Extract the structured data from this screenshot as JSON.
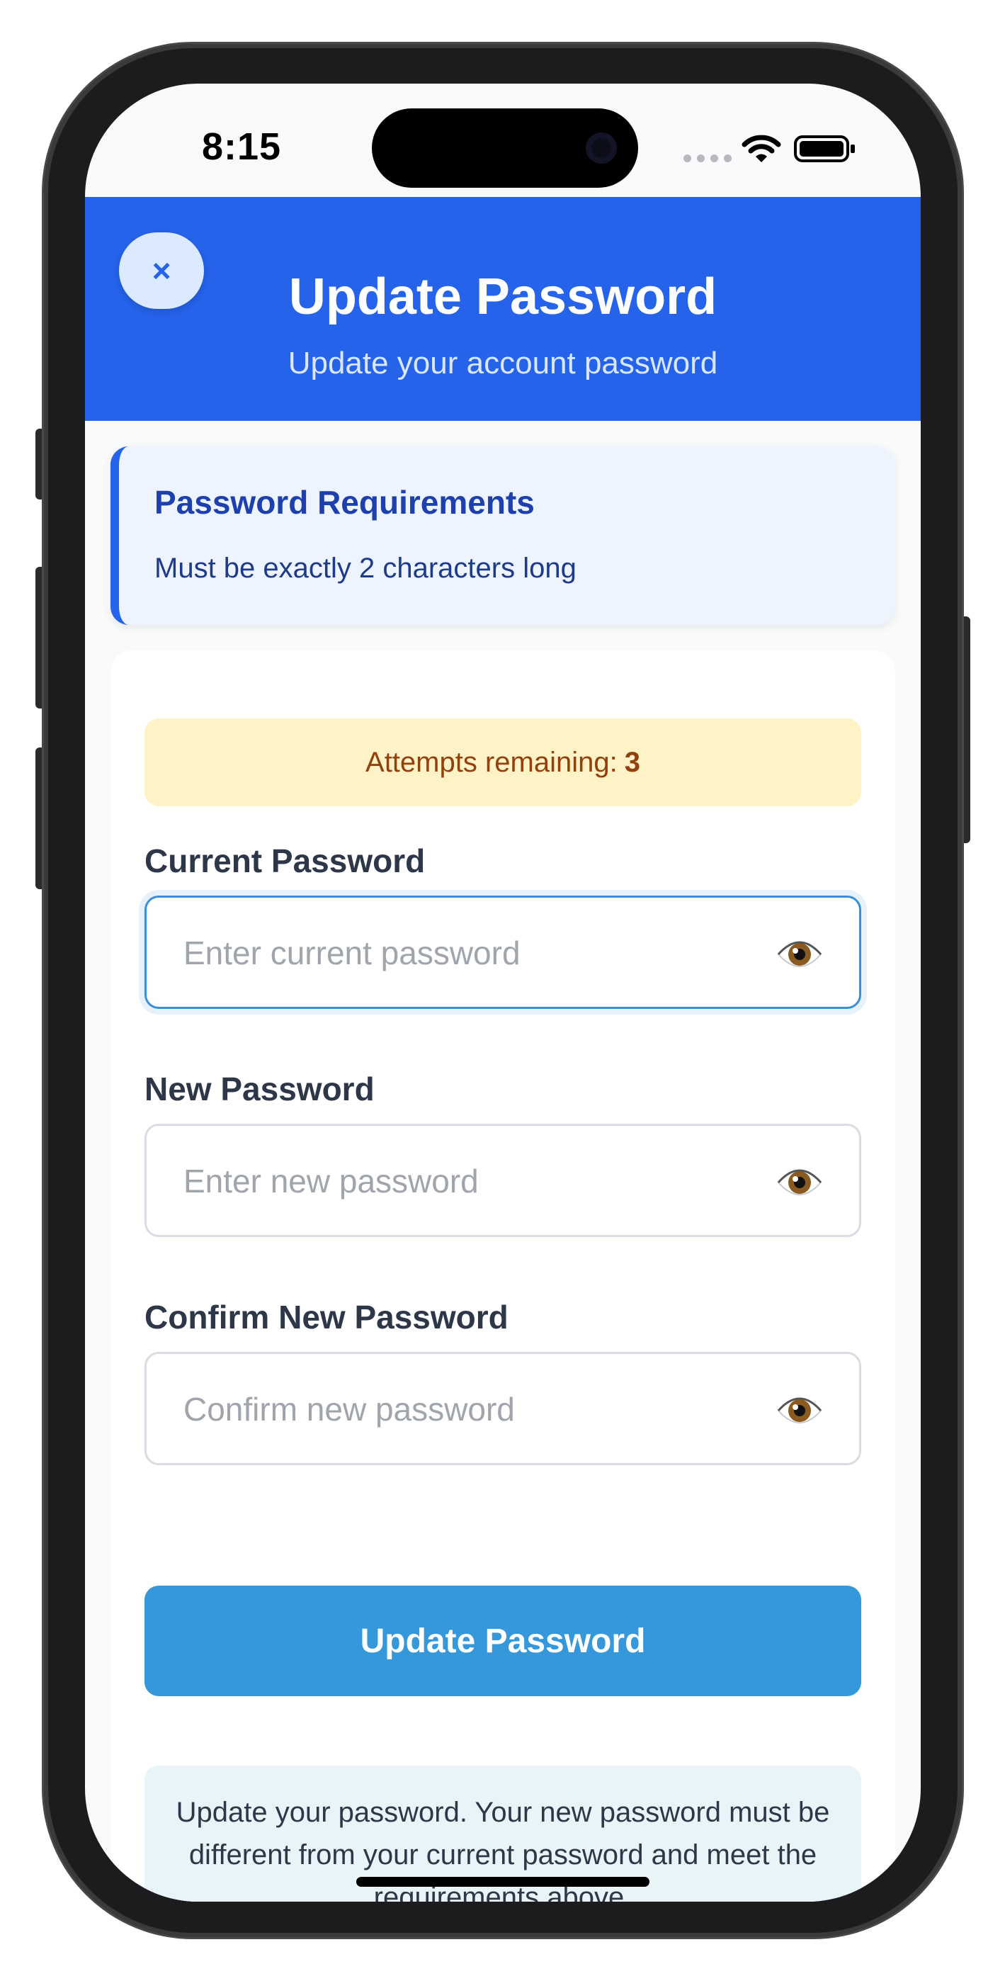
{
  "status_bar": {
    "time": "8:15"
  },
  "header": {
    "close_icon": "×",
    "title": "Update Password",
    "subtitle": "Update your account password"
  },
  "requirements": {
    "title": "Password Requirements",
    "text": "Must be exactly 2 characters long"
  },
  "attempts": {
    "label": "Attempts remaining:",
    "count": "3"
  },
  "fields": {
    "current": {
      "label": "Current Password",
      "placeholder": "Enter current password",
      "value": ""
    },
    "new": {
      "label": "New Password",
      "placeholder": "Enter new password",
      "value": ""
    },
    "confirm": {
      "label": "Confirm New Password",
      "placeholder": "Confirm new password",
      "value": ""
    }
  },
  "submit_label": "Update Password",
  "info_text": "Update your password. Your new password must be different from your current password and meet the requirements above.",
  "colors": {
    "header": "#2563eb",
    "requirements_bg": "#eef4fd",
    "attempts_bg": "#fef3c7",
    "button": "#3498db",
    "info_bg": "#e8f4f8",
    "focus_border": "#3b8fd9"
  },
  "icons": [
    "close-icon",
    "eye-icon",
    "wifi-icon",
    "battery-icon",
    "signal-dots-icon"
  ]
}
